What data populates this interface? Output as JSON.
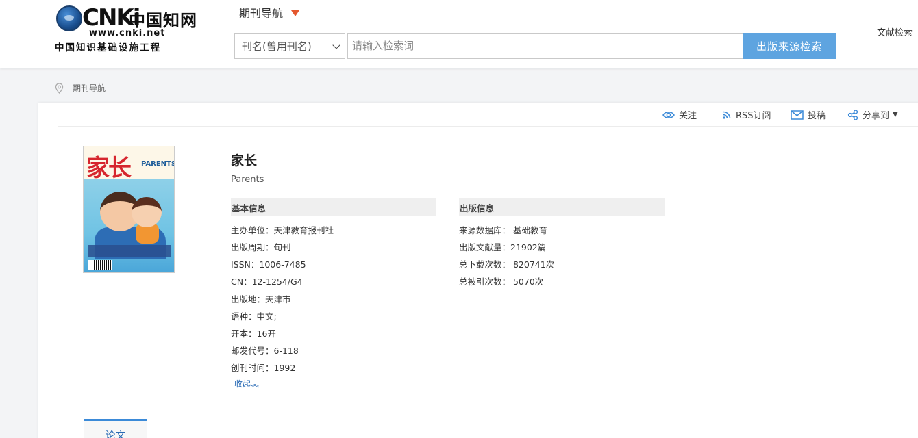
{
  "header": {
    "logo": {
      "brand": "CNKi",
      "brand_cn": "中国知网",
      "url": "www.cnki.net",
      "slogan": "中国知识基础设施工程"
    },
    "nav_title": "期刊导航",
    "search": {
      "field_select": "刊名(曾用刊名)",
      "placeholder": "请输入检索词",
      "button": "出版来源检索"
    },
    "lit_search": "文献检索"
  },
  "breadcrumb": "期刊导航",
  "toolbar": {
    "follow": "关注",
    "rss": "RSS订阅",
    "submit": "投稿",
    "share": "分享到"
  },
  "journal": {
    "cover_title": "家长",
    "cover_en": "PARENTS",
    "title": "家长",
    "english_title": "Parents",
    "basic_info_heading": "基本信息",
    "publish_info_heading": "出版信息",
    "basic_info": [
      "主办单位：天津教育报刊社",
      "出版周期：旬刊",
      "ISSN：1006-7485",
      "CN：12-1254/G4",
      "出版地：天津市",
      "语种：中文;",
      "开本：16开",
      "邮发代号：6-118",
      "创刊时间：1992"
    ],
    "publish_info": [
      "来源数据库： 基础教育",
      "出版文献量：21902篇",
      "总下载次数： 820741次",
      "总被引次数： 5070次"
    ],
    "collapse": "收起︽"
  },
  "tabs": {
    "papers": "论文"
  },
  "colors": {
    "accent_blue": "#5ea4e0",
    "link_blue": "#2a6bb5",
    "nav_triangle": "#e4572e"
  }
}
